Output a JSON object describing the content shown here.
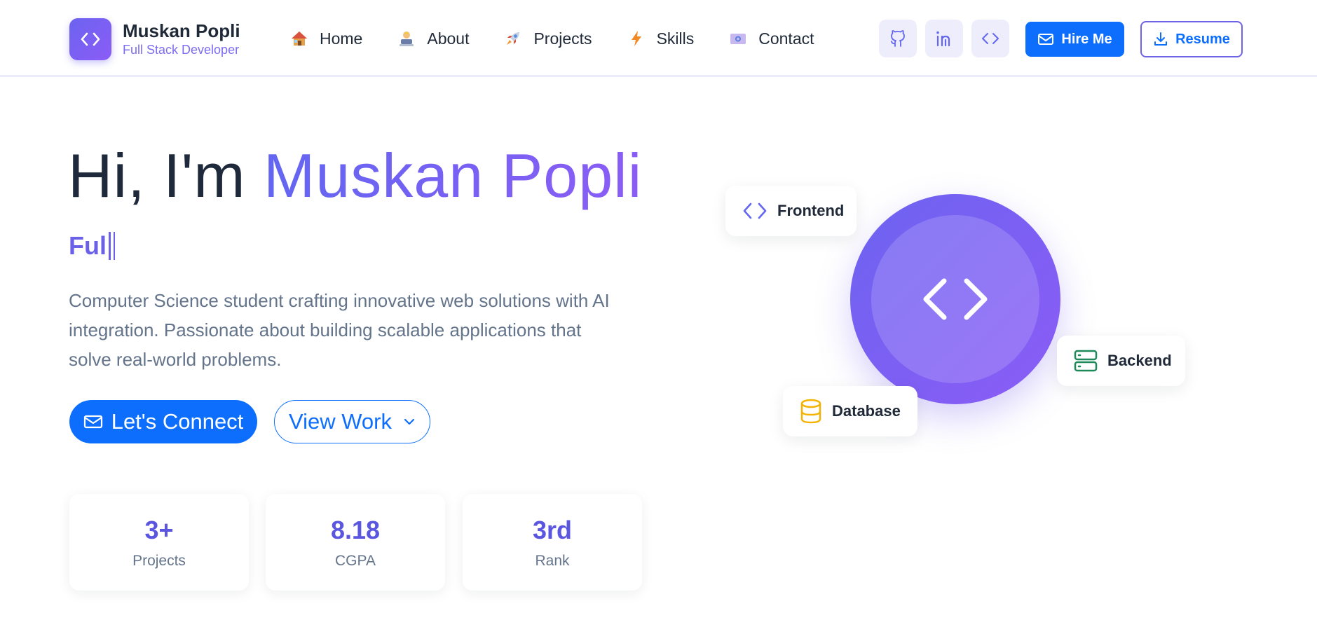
{
  "brand": {
    "name": "Muskan Popli",
    "subtitle": "Full Stack Developer",
    "logo_icon": "code-icon"
  },
  "nav": {
    "items": [
      {
        "label": "Home",
        "icon": "house-emoji"
      },
      {
        "label": "About",
        "icon": "technologist-emoji"
      },
      {
        "label": "Projects",
        "icon": "rocket-emoji"
      },
      {
        "label": "Skills",
        "icon": "lightning-emoji"
      },
      {
        "label": "Contact",
        "icon": "id-card-emoji"
      }
    ],
    "social": [
      "github-icon",
      "linkedin-icon",
      "code-icon"
    ],
    "hire_label": "Hire Me",
    "resume_label": "Resume"
  },
  "hero": {
    "greeting": "Hi, I'm ",
    "name": "Muskan Popli",
    "typed_text": "Ful",
    "description": "Computer Science student crafting innovative web solutions with AI integration. Passionate about building scalable applications that solve real-world problems.",
    "connect_label": "Let's Connect",
    "view_work_label": "View Work"
  },
  "stats": [
    {
      "value": "3+",
      "label": "Projects"
    },
    {
      "value": "8.18",
      "label": "CGPA"
    },
    {
      "value": "3rd",
      "label": "Rank"
    }
  ],
  "illustration": {
    "frontend": "Frontend",
    "backend": "Backend",
    "database": "Database"
  },
  "colors": {
    "primary": "#0d6efd",
    "accent": "#6c63f0",
    "accent_purple": "#8b5cf6",
    "text_dark": "#1e293b",
    "text_muted": "#64748b",
    "backend_green": "#1e8a5a",
    "database_yellow": "#f5b301"
  }
}
